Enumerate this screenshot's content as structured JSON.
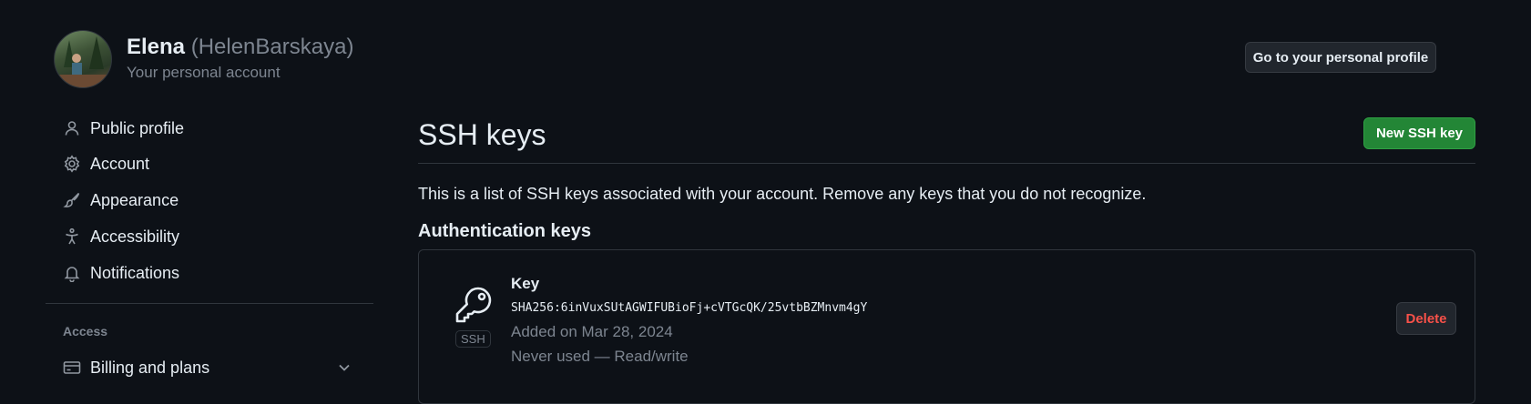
{
  "header": {
    "display_name": "Elena",
    "login": "(HelenBarskaya)",
    "subtitle": "Your personal account",
    "profile_button": "Go to your personal profile"
  },
  "sidebar": {
    "items": [
      {
        "label": "Public profile",
        "icon": "person-icon"
      },
      {
        "label": "Account",
        "icon": "gear-icon"
      },
      {
        "label": "Appearance",
        "icon": "paintbrush-icon"
      },
      {
        "label": "Accessibility",
        "icon": "accessibility-icon"
      },
      {
        "label": "Notifications",
        "icon": "bell-icon"
      }
    ],
    "section_heading": "Access",
    "billing": {
      "label": "Billing and plans",
      "icon": "credit-card-icon",
      "expand_icon": "chevron-down-icon"
    }
  },
  "main": {
    "title": "SSH keys",
    "new_button": "New SSH key",
    "description": "This is a list of SSH keys associated with your account. Remove any keys that you do not recognize.",
    "section_title": "Authentication keys",
    "key": {
      "icon": "key-icon",
      "type_label": "SSH",
      "name": "Key",
      "fingerprint": "SHA256:6inVuxSUtAGWIFUBioFj+cVTGcQK/25vtbBZMnvm4gY",
      "added": "Added on Mar 28, 2024",
      "usage": "Never used — Read/write",
      "delete_button": "Delete"
    }
  },
  "colors": {
    "background": "#0d1117",
    "primary": "#238636",
    "danger": "#f85149",
    "muted": "#7d8590"
  }
}
